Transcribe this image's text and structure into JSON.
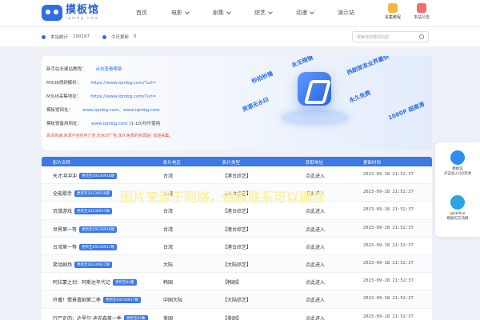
{
  "header": {
    "logo_title": "摸板馆",
    "logo_sub": "i q m b g . c o m",
    "nav": [
      {
        "label": "首页",
        "has_dropdown": false
      },
      {
        "label": "电影",
        "has_dropdown": true
      },
      {
        "label": "剧集",
        "has_dropdown": true
      },
      {
        "label": "综艺",
        "has_dropdown": true
      },
      {
        "label": "动漫",
        "has_dropdown": true
      },
      {
        "label": "演示站",
        "has_dropdown": false
      }
    ],
    "btn_tutorial": "采集教程",
    "btn_notice": "本站公告"
  },
  "stats": {
    "total_label": "本站统计",
    "total_value": "100197",
    "today_label": "今日更新",
    "today_value": "0",
    "search_placeholder": "搜索你想要的内容"
  },
  "hero": {
    "line1_label": "新手站长建站教程：",
    "line1_link": "点击查看帮助",
    "line2_label": "M3U8视频解析：",
    "line2_link": "https://www.iqmbg.com/?url=",
    "line3_label": "M3U8采集地址：",
    "line3_link": "https://www.iqmbg.com/?url=",
    "line4_label": "模板馆网址：",
    "line4_link": "www.iqmbg.com、www.iqmbg.com",
    "line5_label": "模板馆备用网址：",
    "line5_link": "www.iqmbg.com",
    "line5_note": "(1-10)均可使用",
    "warning": "高清高速,资源不含任何广告,无水印广告,永久免费的资源站! 欢迎采集。",
    "deco": [
      "永无暗镜",
      "秒拍秒播",
      "热剧首发业界最快",
      "资源无水印",
      "永久免费",
      "1080P 超高清"
    ]
  },
  "table": {
    "headers": [
      "影片名称",
      "影片地区",
      "影片类型",
      "获取地址",
      "更新时间"
    ],
    "rows": [
      {
        "name": "天才冲冲冲",
        "tag": "更新至20230918期",
        "region": "台湾",
        "type": "【港台综艺】",
        "link": "点此进入",
        "time": "2023-09-18 21:52:37"
      },
      {
        "name": "全能歌手",
        "tag": "更新至20230918期",
        "region": "台湾",
        "type": "【港台综艺】",
        "link": "点此进入",
        "time": "2023-09-18 21:52:37"
      },
      {
        "name": "饥饿游戏",
        "tag": "更新至20230917期",
        "region": "台湾",
        "type": "【港台综艺】",
        "link": "点此进入",
        "time": "2023-09-18 21:52:37"
      },
      {
        "name": "世界第一等",
        "tag": "更新至20230918期",
        "region": "台湾",
        "type": "【港台综艺】",
        "link": "点此进入",
        "time": "2023-09-18 21:52:37"
      },
      {
        "name": "台湾第一等",
        "tag": "更新至20230917期",
        "region": "台湾",
        "type": "【港台综艺】",
        "link": "点此进入",
        "time": "2023-09-18 21:52:37"
      },
      {
        "name": "笑动剧场",
        "tag": "更新至20230917期",
        "region": "大陆",
        "type": "【大陆综艺】",
        "link": "点此进入",
        "time": "2023-09-18 21:52:37"
      },
      {
        "name": "阿拉蒙之剑：阿斯达年代记",
        "tag": "更新至04集",
        "region": "韩国",
        "type": "【韩剧】",
        "link": "点此进入",
        "time": "2023-09-18 21:52:37"
      },
      {
        "name": "开播！情景喜剧第二季",
        "tag": "更新至20230917期",
        "region": "中国大陆",
        "type": "【大陆综艺】",
        "link": "点此进入",
        "time": "2023-09-18 21:52:37"
      },
      {
        "name": "行尸走肉：达里尔·迪克森第一季",
        "tag": "更新至02集",
        "region": "美国",
        "type": "【美剧】",
        "link": "点此进入",
        "time": "2023-09-18 21:52:37"
      }
    ]
  },
  "watermark": "图片来源于网络，侵权联系可以删除",
  "float_panel": {
    "qq_title": "模板馆",
    "qq_desc": "点击加入QQ资源",
    "tg_title": "@bbllike",
    "tg_desc": "模板馆交流群"
  },
  "colors": {
    "primary": "#2e6ee6",
    "header_table": "#3c78e6",
    "warning": "#e04a3a"
  }
}
